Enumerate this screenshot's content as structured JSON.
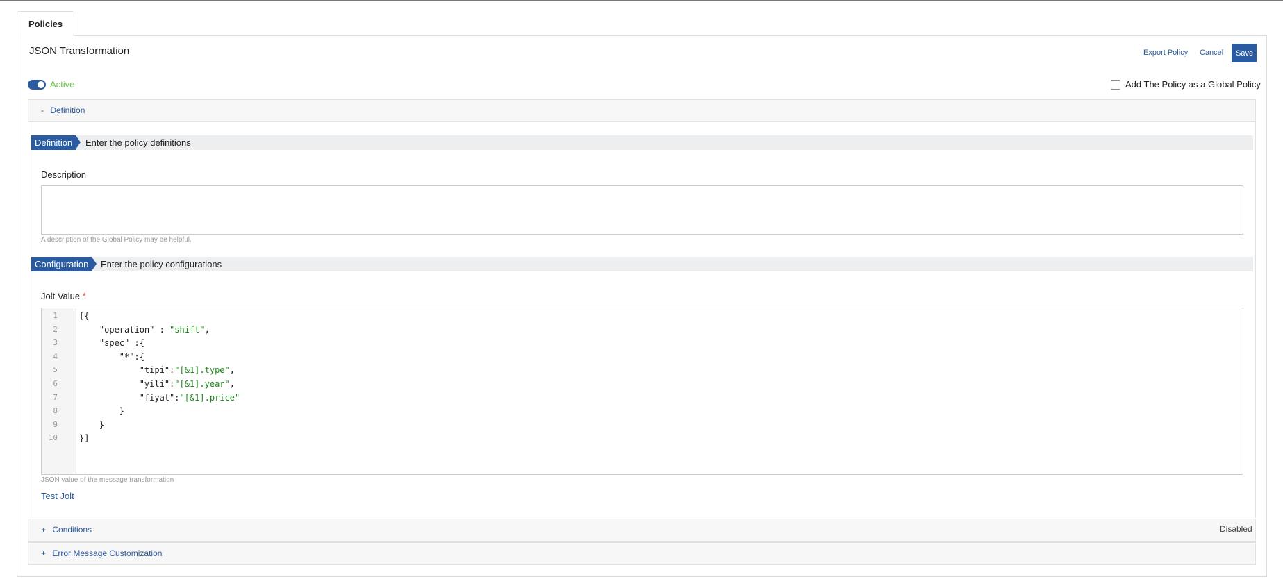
{
  "tabs": {
    "policies": "Policies"
  },
  "header": {
    "title": "JSON Transformation",
    "export_label": "Export Policy",
    "cancel_label": "Cancel",
    "save_label": "Save"
  },
  "status": {
    "active_label": "Active",
    "global_policy_label": "Add The Policy as a Global Policy"
  },
  "accordion": {
    "definition": {
      "sign": "-",
      "label": "Definition"
    },
    "conditions": {
      "sign": "+",
      "label": "Conditions",
      "status": "Disabled"
    },
    "error": {
      "sign": "+",
      "label": "Error Message Customization"
    }
  },
  "definition_section": {
    "chip": "Definition",
    "text": "Enter the policy definitions",
    "description_label": "Description",
    "description_hint": "A description of the Global Policy may be helpful."
  },
  "configuration_section": {
    "chip": "Configuration",
    "text": "Enter the policy configurations",
    "jolt_label": "Jolt Value",
    "required_mark": "*",
    "jolt_hint": "JSON value of the message transformation",
    "test_label": "Test Jolt"
  },
  "editor": {
    "lines": [
      {
        "n": "1",
        "parts": [
          [
            "p",
            "[{"
          ]
        ]
      },
      {
        "n": "2",
        "parts": [
          [
            "p",
            "    \"operation\" : "
          ],
          [
            "s",
            "\"shift\""
          ],
          [
            "p",
            ","
          ]
        ]
      },
      {
        "n": "3",
        "parts": [
          [
            "p",
            "    \"spec\" :{"
          ]
        ]
      },
      {
        "n": "4",
        "parts": [
          [
            "p",
            "        \"*\":{"
          ]
        ]
      },
      {
        "n": "5",
        "parts": [
          [
            "p",
            "            \"tipi\":"
          ],
          [
            "s",
            "\"[&1].type\""
          ],
          [
            "p",
            ","
          ]
        ]
      },
      {
        "n": "6",
        "parts": [
          [
            "p",
            "            \"yili\":"
          ],
          [
            "s",
            "\"[&1].year\""
          ],
          [
            "p",
            ","
          ]
        ]
      },
      {
        "n": "7",
        "parts": [
          [
            "p",
            "            \"fiyat\":"
          ],
          [
            "s",
            "\"[&1].price\""
          ]
        ]
      },
      {
        "n": "8",
        "parts": [
          [
            "p",
            "        }"
          ]
        ]
      },
      {
        "n": "9",
        "parts": [
          [
            "p",
            "    }"
          ]
        ]
      },
      {
        "n": "10",
        "parts": [
          [
            "p",
            "}]"
          ]
        ]
      }
    ]
  }
}
